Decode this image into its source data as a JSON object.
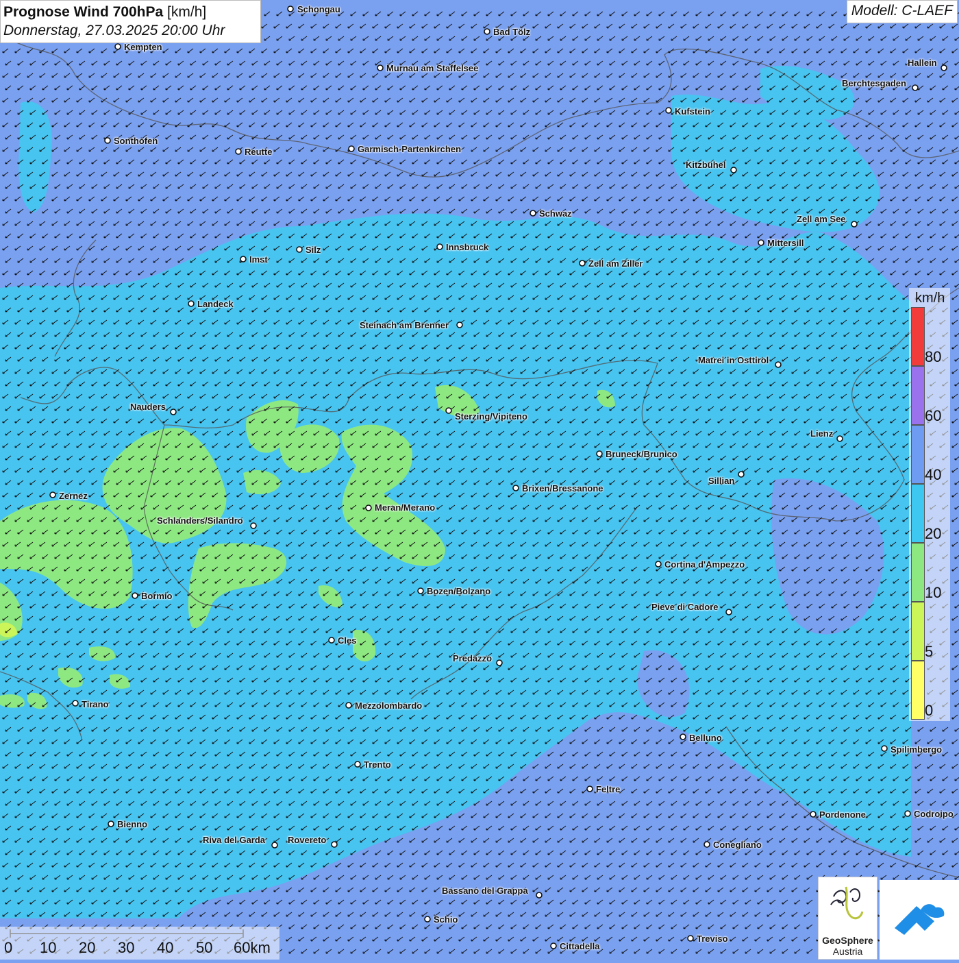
{
  "header": {
    "title_bold": "Prognose Wind 700hPa",
    "title_unit": "[km/h]",
    "datetime": "Donnerstag, 27.03.2025 20:00 Uhr",
    "model": "Modell: C-LAEF"
  },
  "cities": [
    {
      "name": "Schongau"
    },
    {
      "name": "Bad Tölz"
    },
    {
      "name": "Kempten"
    },
    {
      "name": "Murnau am Staffelsee"
    },
    {
      "name": "Hallein"
    },
    {
      "name": "Berchtesgaden"
    },
    {
      "name": "Kufstein"
    },
    {
      "name": "Sonthofen"
    },
    {
      "name": "Reutte"
    },
    {
      "name": "Garmisch-Partenkirchen"
    },
    {
      "name": "Kitzbühel"
    },
    {
      "name": "Schwaz"
    },
    {
      "name": "Zell am See"
    },
    {
      "name": "Mittersill"
    },
    {
      "name": "Innsbruck"
    },
    {
      "name": "Silz"
    },
    {
      "name": "Imst"
    },
    {
      "name": "Zell am Ziller"
    },
    {
      "name": "Landeck"
    },
    {
      "name": "Steinach am Brenner"
    },
    {
      "name": "Matrei in Osttirol"
    },
    {
      "name": "Nauders"
    },
    {
      "name": "Sterzing/Vipiteno"
    },
    {
      "name": "Lienz"
    },
    {
      "name": "Bruneck/Brunico"
    },
    {
      "name": "Sillian"
    },
    {
      "name": "Zernez"
    },
    {
      "name": "Brixen/Bressanone"
    },
    {
      "name": "Meran/Merano"
    },
    {
      "name": "Schlanders/Silandro"
    },
    {
      "name": "Cortina d'Ampezzo"
    },
    {
      "name": "Bozen/Bolzano"
    },
    {
      "name": "Bormio"
    },
    {
      "name": "Pieve di Cadore"
    },
    {
      "name": "Cles"
    },
    {
      "name": "Predazzo"
    },
    {
      "name": "Tirano"
    },
    {
      "name": "Mezzolombardo"
    },
    {
      "name": "Belluno"
    },
    {
      "name": "Spilimbergo"
    },
    {
      "name": "Trento"
    },
    {
      "name": "Feltre"
    },
    {
      "name": "Pordenone"
    },
    {
      "name": "Codroipo"
    },
    {
      "name": "Bienno"
    },
    {
      "name": "Riva del Garda"
    },
    {
      "name": "Rovereto"
    },
    {
      "name": "Conegliano"
    },
    {
      "name": "Bassano del Grappa"
    },
    {
      "name": "Schio"
    },
    {
      "name": "Treviso"
    },
    {
      "name": "Cittadella"
    }
  ],
  "legend": {
    "unit": "km/h",
    "classes": [
      {
        "label": "0",
        "color": "#ffff66"
      },
      {
        "label": "5",
        "color": "#ccf55a"
      },
      {
        "label": "10",
        "color": "#8ee882"
      },
      {
        "label": "20",
        "color": "#3cc8f0"
      },
      {
        "label": "40",
        "color": "#6d9cf2"
      },
      {
        "label": "60",
        "color": "#9a72ee"
      },
      {
        "label": "80",
        "color": "#f23c3c"
      }
    ]
  },
  "scale": {
    "labels": [
      "0",
      "10",
      "20",
      "30",
      "40",
      "50",
      "60km"
    ]
  },
  "logo": {
    "name_line1": "GeoSphere",
    "name_line2": "Austria"
  },
  "wind": {
    "direction": "from northeast",
    "arrow_color": "#111111"
  }
}
